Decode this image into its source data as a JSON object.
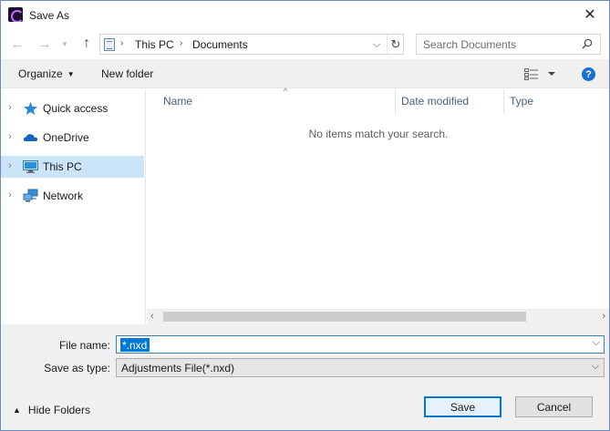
{
  "window": {
    "title": "Save As",
    "close_glyph": "✕"
  },
  "navigation": {
    "back_glyph": "←",
    "forward_glyph": "→",
    "recent_glyph": "▾",
    "up_glyph": "↑"
  },
  "address": {
    "crumbs": [
      "This PC",
      "Documents"
    ],
    "separator": "›",
    "dropdown_glyph": "⌵",
    "refresh_glyph": "↻"
  },
  "search": {
    "placeholder": "Search Documents",
    "icon": "search-icon"
  },
  "toolbar": {
    "organize_label": "Organize",
    "organize_caret": "▼",
    "new_folder_label": "New folder",
    "help_label": "?"
  },
  "nav_pane": {
    "items": [
      {
        "label": "Quick access",
        "icon": "star-icon",
        "selected": false
      },
      {
        "label": "OneDrive",
        "icon": "cloud-icon",
        "selected": false
      },
      {
        "label": "This PC",
        "icon": "computer-icon",
        "selected": true
      },
      {
        "label": "Network",
        "icon": "network-icon",
        "selected": false
      }
    ],
    "chevron_glyph": "›"
  },
  "file_list": {
    "columns": [
      "Name",
      "Date modified",
      "Type"
    ],
    "sort_glyph": "^",
    "empty_message": "No items match your search.",
    "scroll_left_glyph": "‹",
    "scroll_right_glyph": "›"
  },
  "form": {
    "file_name_label": "File name:",
    "file_name_value": "*.nxd",
    "save_type_label": "Save as type:",
    "save_type_value": "Adjustments File(*.nxd)",
    "dropdown_glyph": "⌵"
  },
  "footer": {
    "hide_folders_label": "Hide Folders",
    "hide_caret": "▲",
    "save_label": "Save",
    "cancel_label": "Cancel"
  },
  "colors": {
    "accent": "#0078d7",
    "selected_bg": "#cce4f7",
    "toolbar_bg": "#f0f0f0"
  }
}
